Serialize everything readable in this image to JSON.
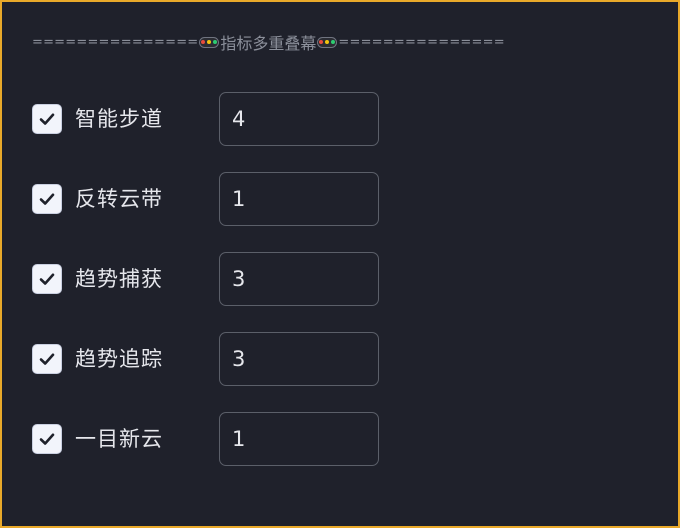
{
  "header": {
    "prefix": "===============",
    "title": "指标多重叠幕",
    "suffix": "===============",
    "icon": "traffic-light-icon",
    "icon_colors": [
      "#e74c3c",
      "#f1c40f",
      "#2ecc71"
    ]
  },
  "colors": {
    "background": "#1f212b",
    "frame_border": "#e9a92a",
    "checkbox_fill": "#f2f4fb",
    "checkmark": "#1f212b"
  },
  "indicators": [
    {
      "label": "智能步道",
      "checked": true,
      "value": "4"
    },
    {
      "label": "反转云带",
      "checked": true,
      "value": "1"
    },
    {
      "label": "趋势捕获",
      "checked": true,
      "value": "3"
    },
    {
      "label": "趋势追踪",
      "checked": true,
      "value": "3"
    },
    {
      "label": "一目新云",
      "checked": true,
      "value": "1"
    }
  ]
}
